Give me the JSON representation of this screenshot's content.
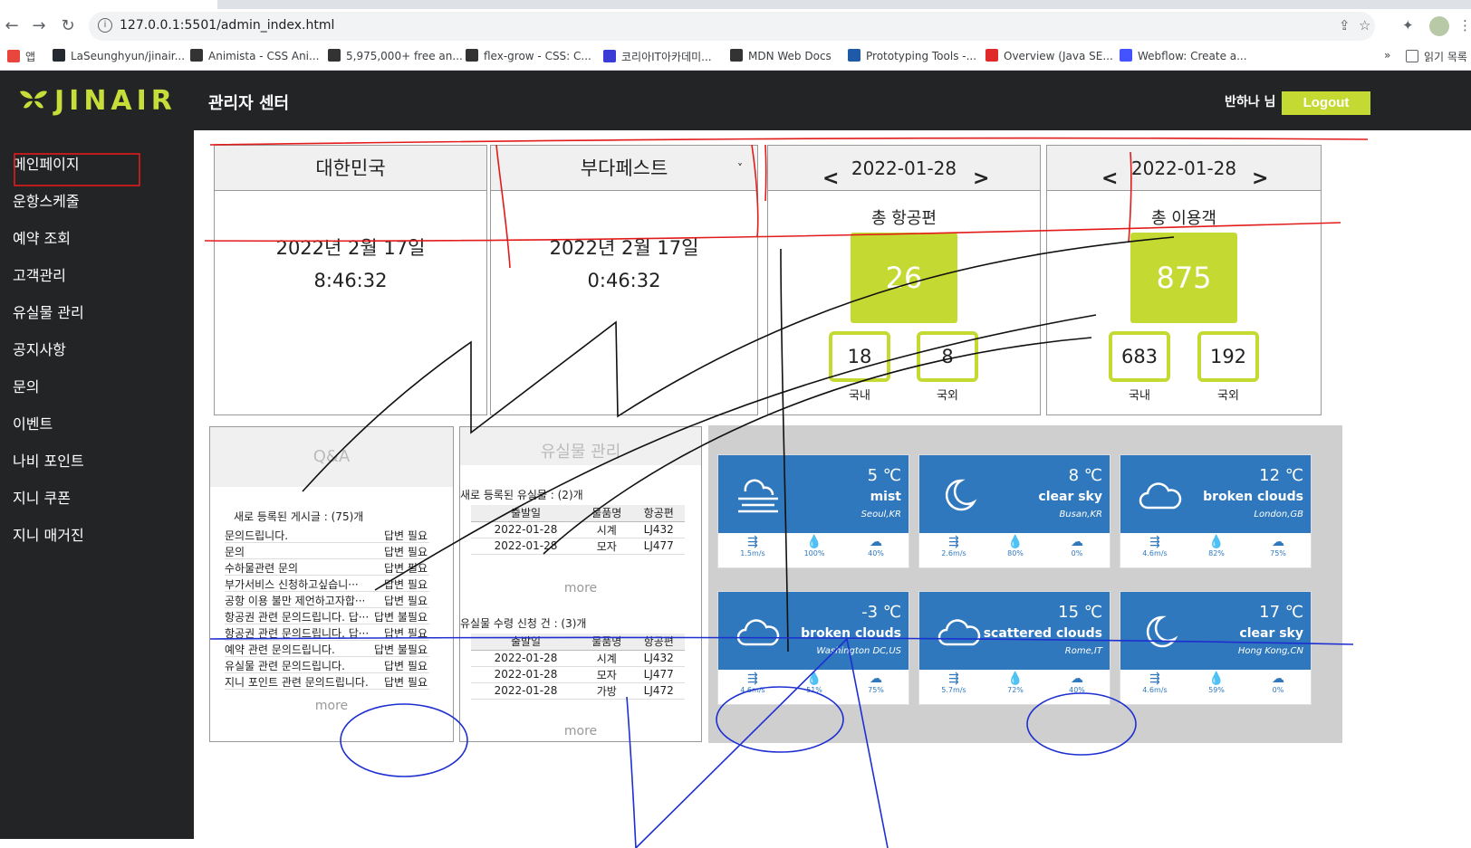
{
  "browser": {
    "url": "127.0.0.1:5501/admin_index.html",
    "bookmarks": [
      {
        "label": "앱",
        "color": "#e8453c"
      },
      {
        "label": "LaSeunghyun/jinair...",
        "color": "#24292f"
      },
      {
        "label": "Animista - CSS Ani...",
        "color": "#333333"
      },
      {
        "label": "5,975,000+ free an...",
        "color": "#333333"
      },
      {
        "label": "flex-grow - CSS: C...",
        "color": "#333333"
      },
      {
        "label": "코리아IT아카데미...",
        "color": "#3b3bd6"
      },
      {
        "label": "MDN Web Docs",
        "color": "#333333"
      },
      {
        "label": "Prototyping Tools -...",
        "color": "#1e5aa8"
      },
      {
        "label": "Overview (Java SE...",
        "color": "#e02a2a"
      },
      {
        "label": "Webflow: Create a...",
        "color": "#4353ff"
      }
    ],
    "overflow_label": "»",
    "reading_list_label": "읽기 목록"
  },
  "header": {
    "logo_text": "JINAIR",
    "title": "관리자 센터",
    "greeting": "반하나 님",
    "logout_label": "Logout",
    "accent_color": "#c5d933"
  },
  "sidebar": {
    "items": [
      "메인페이지",
      "운항스케줄",
      "예약 조회",
      "고객관리",
      "유실물 관리",
      "공지사항",
      "문의",
      "이벤트",
      "나비 포인트",
      "지니 쿠폰",
      "지니 매거진"
    ]
  },
  "clocks": [
    {
      "city": "대한민국",
      "date": "2022년 2월 17일",
      "time": "8:46:32"
    },
    {
      "city": "부다페스트",
      "date": "2022년 2월 17일",
      "time": "0:46:32"
    }
  ],
  "flights": {
    "date": "2022-01-28",
    "label": "총 항공편",
    "total": "26",
    "domestic": "18",
    "international": "8",
    "domestic_label": "국내",
    "international_label": "국외"
  },
  "passengers": {
    "date": "2022-01-28",
    "label": "총 이용객",
    "total": "875",
    "domestic": "683",
    "international": "192",
    "domestic_label": "국내",
    "international_label": "국외"
  },
  "qa": {
    "title": "Q&A",
    "caption": "새로 등록된 게시글 : (75)개",
    "rows": [
      {
        "title": "문의드립니다.",
        "status": "답변 필요"
      },
      {
        "title": "문의",
        "status": "답변 필요"
      },
      {
        "title": "수하물관련 문의",
        "status": "답변 필요"
      },
      {
        "title": "부가서비스 신청하고싶습니···",
        "status": "답변 필요"
      },
      {
        "title": "공항 이용 불만 제언하고자합···",
        "status": "답변 필요"
      },
      {
        "title": "항공권 관련 문의드립니다. 답···",
        "status": "답변 불필요"
      },
      {
        "title": "항공권 관련 문의드립니다. 답···",
        "status": "답변 필요"
      },
      {
        "title": "예약 관련 문의드립니다.",
        "status": "답변 불필요"
      },
      {
        "title": "유실물 관련 문의드립니다.",
        "status": "답변 필요"
      },
      {
        "title": "지니 포인트 관련 문의드립니다.",
        "status": "답변 필요"
      }
    ],
    "more": "more"
  },
  "lost": {
    "title": "유실물 관리",
    "new_caption": "새로 등록된 유실물 : (2)개",
    "headers": [
      "출발일",
      "물품명",
      "항공편"
    ],
    "new_rows": [
      [
        "2022-01-28",
        "시계",
        "LJ432"
      ],
      [
        "2022-01-28",
        "모자",
        "LJ477"
      ]
    ],
    "more1": "more",
    "claim_caption": "유실물 수령 신청 건 : (3)개",
    "claim_rows": [
      [
        "2022-01-28",
        "시계",
        "LJ432"
      ],
      [
        "2022-01-28",
        "모자",
        "LJ477"
      ],
      [
        "2022-01-28",
        "가방",
        "LJ472"
      ]
    ],
    "more2": "more"
  },
  "weather": [
    {
      "temp": "5 ℃",
      "desc": "mist",
      "loc": "Seoul,KR",
      "icon": "mist-icon",
      "wind": "1.5m/s",
      "humidity": "100%",
      "clouds": "40%"
    },
    {
      "temp": "8 ℃",
      "desc": "clear sky",
      "loc": "Busan,KR",
      "icon": "moon-icon",
      "wind": "2.6m/s",
      "humidity": "80%",
      "clouds": "0%"
    },
    {
      "temp": "12 ℃",
      "desc": "broken clouds",
      "loc": "London,GB",
      "icon": "cloud-icon",
      "wind": "4.6m/s",
      "humidity": "82%",
      "clouds": "75%"
    },
    {
      "temp": "-3 ℃",
      "desc": "broken clouds",
      "loc": "Washington DC,US",
      "icon": "cloud-icon",
      "wind": "4.6m/s",
      "humidity": "51%",
      "clouds": "75%"
    },
    {
      "temp": "15 ℃",
      "desc": "scattered clouds",
      "loc": "Rome,IT",
      "icon": "cloud-icon",
      "wind": "5.7m/s",
      "humidity": "72%",
      "clouds": "40%"
    },
    {
      "temp": "17 ℃",
      "desc": "clear sky",
      "loc": "Hong Kong,CN",
      "icon": "moon-icon",
      "wind": "4.6m/s",
      "humidity": "59%",
      "clouds": "0%"
    }
  ],
  "colors": {
    "weather_blue": "#2f78bd",
    "annotation_red": "#e21b1b",
    "annotation_blue": "#1d2fd1",
    "annotation_black": "#111111"
  }
}
